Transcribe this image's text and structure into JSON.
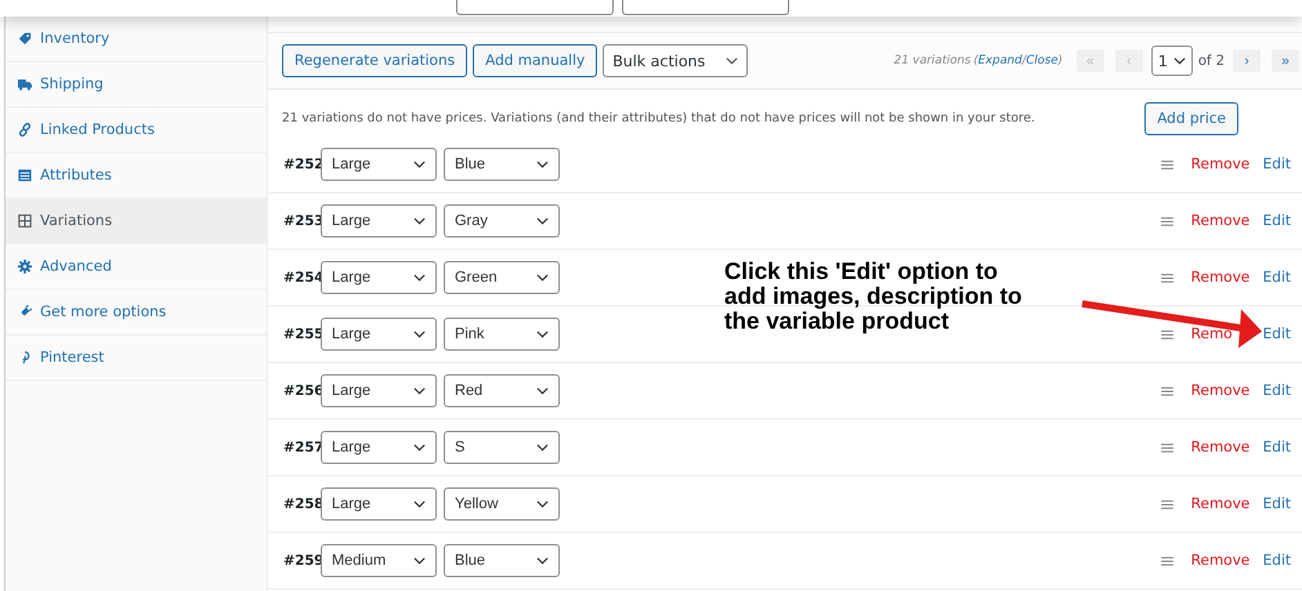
{
  "sidebar": {
    "items": [
      {
        "label": "Inventory",
        "selected": false
      },
      {
        "label": "Shipping",
        "selected": false
      },
      {
        "label": "Linked Products",
        "selected": false
      },
      {
        "label": "Attributes",
        "selected": false
      },
      {
        "label": "Variations",
        "selected": true
      },
      {
        "label": "Advanced",
        "selected": false
      },
      {
        "label": "Get more options",
        "selected": false
      },
      {
        "label": "Pinterest",
        "selected": false
      }
    ]
  },
  "toolbar": {
    "buttons": [
      "Regenerate variations",
      "Add manually"
    ],
    "bulk_actions": "Bulk actions",
    "count": "21 variations",
    "paren_open": "(",
    "expand": "Expand",
    "separator": "/",
    "close": "Close",
    "paren_close": ")",
    "pagination": [
      {
        "label": "«",
        "disabled": true
      },
      {
        "label": "‹",
        "disabled": true
      },
      {
        "label": "›",
        "disabled": false
      },
      {
        "label": "»",
        "disabled": false
      }
    ],
    "page": "1",
    "of_pages": "of 2"
  },
  "notice": {
    "text": "21 variations do not have prices. Variations (and their attributes) that do not have prices will not be shown in your store.",
    "button": "Add price"
  },
  "variations": [
    {
      "id": "#252",
      "options": [
        "Large",
        "Blue"
      ],
      "remove": "Remove",
      "edit": "Edit"
    },
    {
      "id": "#253",
      "options": [
        "Large",
        "Gray"
      ],
      "remove": "Remove",
      "edit": "Edit"
    },
    {
      "id": "#254",
      "options": [
        "Large",
        "Green"
      ],
      "remove": "Remove",
      "edit": "Edit"
    },
    {
      "id": "#255",
      "options": [
        "Large",
        "Pink"
      ],
      "remove": "Remo",
      "edit": "Edit"
    },
    {
      "id": "#256",
      "options": [
        "Large",
        "Red"
      ],
      "remove": "Remove",
      "edit": "Edit"
    },
    {
      "id": "#257",
      "options": [
        "Large",
        "S"
      ],
      "remove": "Remove",
      "edit": "Edit"
    },
    {
      "id": "#258",
      "options": [
        "Large",
        "Yellow"
      ],
      "remove": "Remove",
      "edit": "Edit"
    },
    {
      "id": "#259",
      "options": [
        "Medium",
        "Blue"
      ],
      "remove": "Remove",
      "edit": "Edit"
    }
  ],
  "annotation": {
    "text": "Click this 'Edit' option to add images, description to the variable product"
  }
}
